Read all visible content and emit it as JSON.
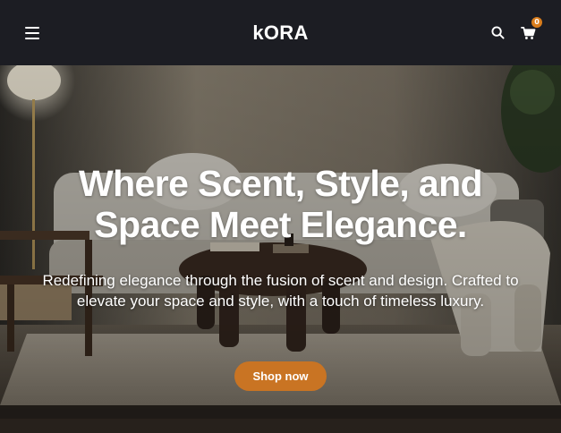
{
  "header": {
    "logo": "kORA",
    "cart_count": "0"
  },
  "hero": {
    "title": "Where Scent, Style, and Space Meet Elegance.",
    "subtitle": "Redefining elegance through the fusion of scent and design. Crafted to elevate your space and style, with a touch of timeless luxury.",
    "cta_label": "Shop now"
  },
  "icons": [
    "menu-icon",
    "search-icon",
    "cart-icon"
  ],
  "colors": {
    "header_bg": "#1c1d23",
    "accent": "#c97423",
    "badge": "#d97d1c"
  }
}
